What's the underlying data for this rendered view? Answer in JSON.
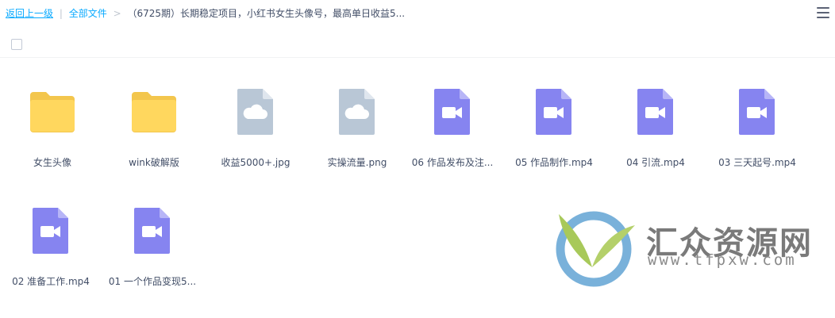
{
  "breadcrumb": {
    "back": "返回上一级",
    "separator": "|",
    "root": "全部文件",
    "arrow": ">",
    "current": "（6725期）长期稳定项目，小红书女生头像号，最高单日收益5..."
  },
  "icons": {
    "menu": "list-menu-icon",
    "folder": "folder-icon",
    "image": "image-file-icon",
    "video": "video-file-icon"
  },
  "colors": {
    "link": "#09aaff",
    "folder": "#ffd75e",
    "image_file": "#b9c7d6",
    "video_file": "#8684f0"
  },
  "files": [
    {
      "name": "女生头像",
      "type": "folder"
    },
    {
      "name": "wink破解版",
      "type": "folder"
    },
    {
      "name": "收益5000+.jpg",
      "type": "image"
    },
    {
      "name": "实操流量.png",
      "type": "image"
    },
    {
      "name": "06 作品发布及注...",
      "type": "video"
    },
    {
      "name": "05 作品制作.mp4",
      "type": "video"
    },
    {
      "name": "04 引流.mp4",
      "type": "video"
    },
    {
      "name": "03 三天起号.mp4",
      "type": "video"
    },
    {
      "name": "02 准备工作.mp4",
      "type": "video"
    },
    {
      "name": "01 一个作品变现5...",
      "type": "video"
    }
  ],
  "watermark": {
    "title": "汇众资源网",
    "url": "www.tfpxw.com"
  }
}
